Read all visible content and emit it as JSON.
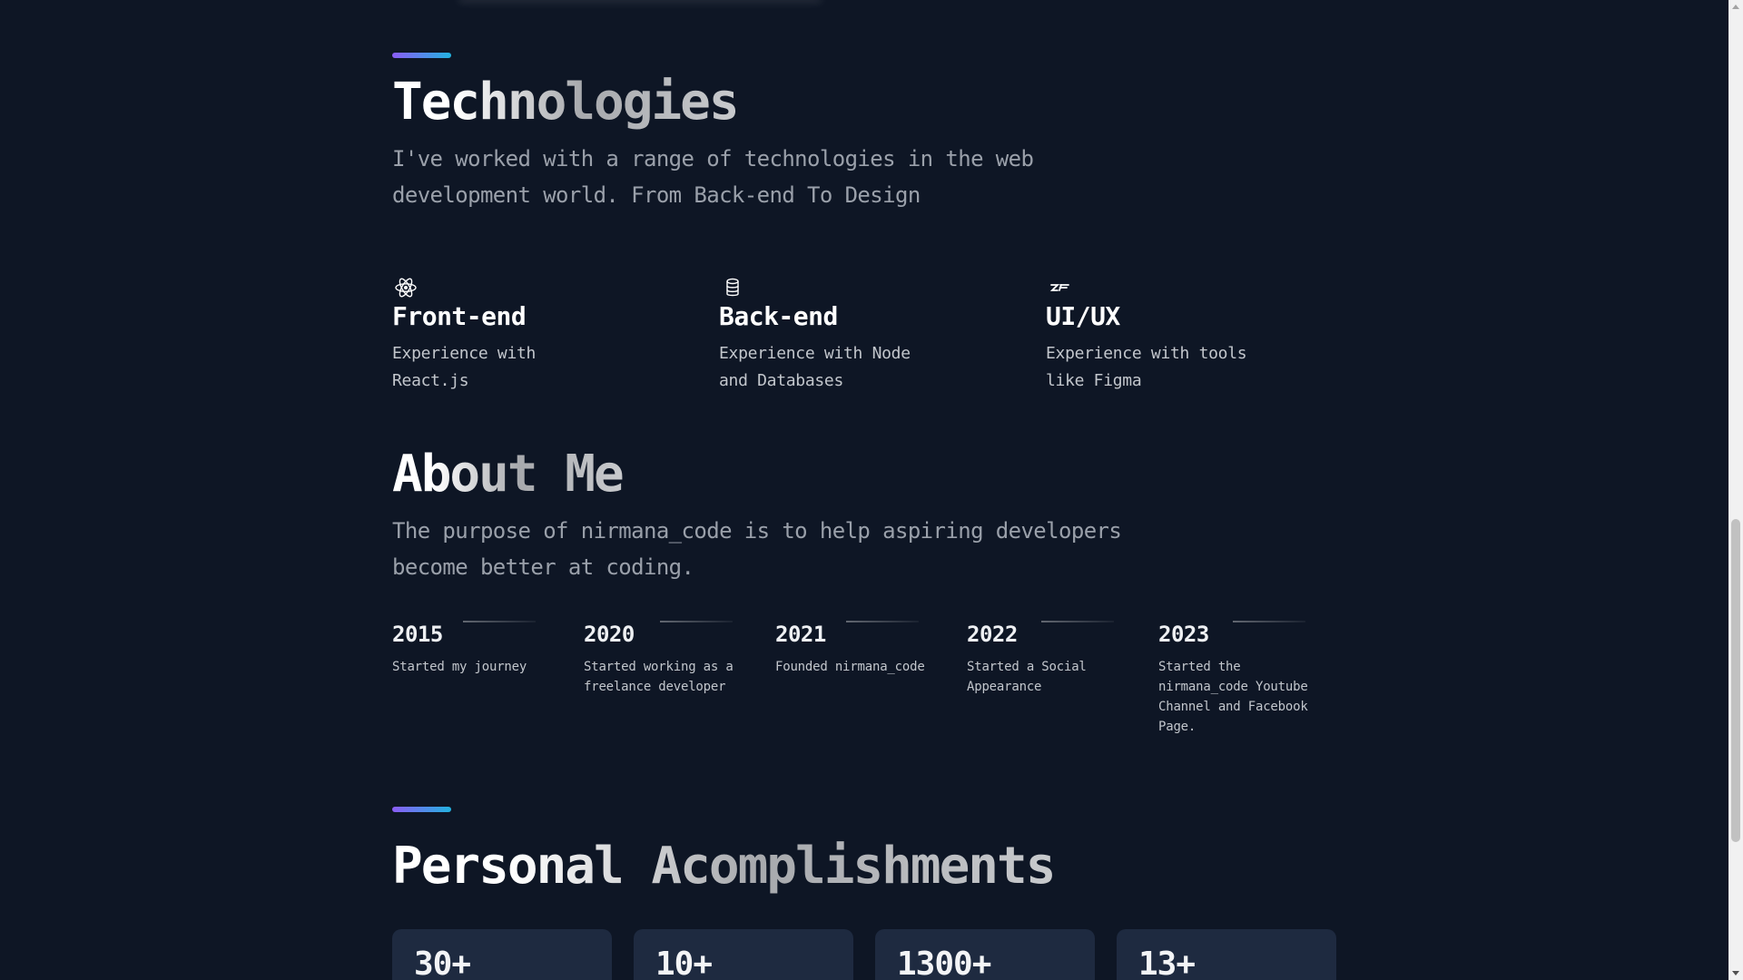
{
  "technologies": {
    "title": "Technologies",
    "description": "I've worked with a range of technologies in the web development world. From Back-end To Design",
    "items": [
      {
        "icon": "react-icon",
        "title": "Front-end",
        "description": "Experience with React.js"
      },
      {
        "icon": "database-icon",
        "title": "Back-end",
        "description": "Experience with Node and Databases"
      },
      {
        "icon": "zeplin-icon",
        "title": "UI/UX",
        "description": "Experience with tools like Figma"
      }
    ]
  },
  "about": {
    "title": "About Me",
    "description": "The purpose of nirmana_code is to help aspiring developers become better at coding.",
    "timeline": [
      {
        "year": "2015",
        "text": "Started my journey"
      },
      {
        "year": "2020",
        "text": "Started working as a freelance developer"
      },
      {
        "year": "2021",
        "text": "Founded nirmana_code"
      },
      {
        "year": "2022",
        "text": "Started a Social Appearance"
      },
      {
        "year": "2023",
        "text": "Started the nirmana_code Youtube Channel and Facebook Page."
      }
    ]
  },
  "accomplishments": {
    "title": "Personal Acomplishments",
    "stats": [
      {
        "value": "30+"
      },
      {
        "value": "10+"
      },
      {
        "value": "1300+"
      },
      {
        "value": "13+"
      }
    ]
  },
  "colors": {
    "background": "#0e1625",
    "card": "#1e2a40",
    "accent_start": "#8b5cf6",
    "accent_end": "#22b3e0"
  }
}
